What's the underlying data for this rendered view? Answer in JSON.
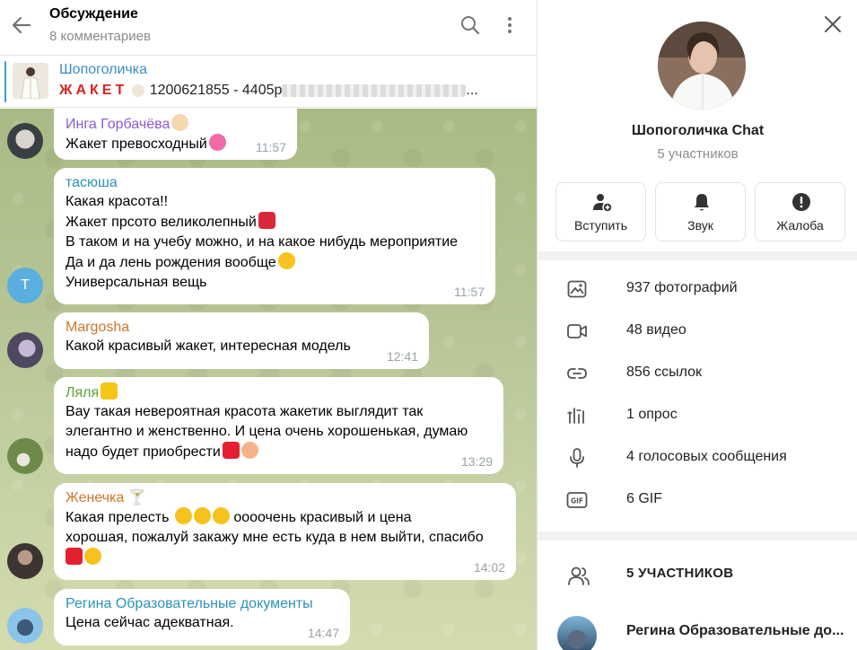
{
  "header": {
    "title": "Обсуждение",
    "subtitle": "8 комментариев"
  },
  "pinned": {
    "title": "Шопоголичка",
    "red_text": "ЖАКЕТ",
    "text": "1200621855 - 4405р",
    "trailing": "..."
  },
  "messages": [
    {
      "name": "Инга Горбачёва",
      "name_color": "#8e5ad4",
      "lines": [
        "Жакет превосходный"
      ],
      "time": "11:57"
    },
    {
      "name": "тасюша",
      "name_color": "#2d93b8",
      "lines": [
        "Какая красота!!",
        "Жакет прсото великолепный",
        "В таком и на учебу можно, и на какое нибудь мероприятие",
        "Да и да лень рождения вообще",
        "Универсальная вещь"
      ],
      "time": "11:57",
      "avatar_letter": "Т"
    },
    {
      "name": "Margosha",
      "name_color": "#d0762c",
      "lines": [
        "Какой красивый жакет, интересная модель"
      ],
      "time": "12:41"
    },
    {
      "name": "Ляля",
      "name_color": "#58a436",
      "lines": [
        "Вау такая невероятная красота жакетик выглядит так",
        "элегантно и женственно. И цена очень хорошенькая, думаю",
        "надо будет приобрести"
      ],
      "time": "13:29"
    },
    {
      "name": "Женечка",
      "name_color": "#d0762c",
      "lines": [
        "Какая прелесть",
        "оооочень красивый и цена",
        "хорошая, пожалуй закажу мне есть куда в нем выйти, спасибо"
      ],
      "time": "14:02"
    },
    {
      "name": "Регина Образовательные документы",
      "name_color": "#2d93b8",
      "lines": [
        "Цена сейчас адекватная."
      ],
      "time": "14:47"
    }
  ],
  "panel": {
    "name": "Шопоголичка Chat",
    "subtitle": "5 участников",
    "actions": [
      {
        "label": "Вступить",
        "icon": "add-user-icon"
      },
      {
        "label": "Звук",
        "icon": "bell-icon"
      },
      {
        "label": "Жалоба",
        "icon": "report-icon"
      }
    ],
    "media": [
      {
        "label": "937 фотографий",
        "icon": "photo-icon"
      },
      {
        "label": "48 видео",
        "icon": "video-icon"
      },
      {
        "label": "856 ссылок",
        "icon": "link-icon"
      },
      {
        "label": "1 опрос",
        "icon": "poll-icon"
      },
      {
        "label": "4 голосовых сообщения",
        "icon": "microphone-icon"
      },
      {
        "label": "6 GIF",
        "icon": "gif-icon"
      }
    ],
    "members_title": "5 УЧАСТНИКОВ",
    "first_member": "Регина Образовательные до..."
  },
  "colors": {
    "accent": "#3a8ec6",
    "icon_gray": "#707579",
    "chat_bg": "#b7c596"
  }
}
